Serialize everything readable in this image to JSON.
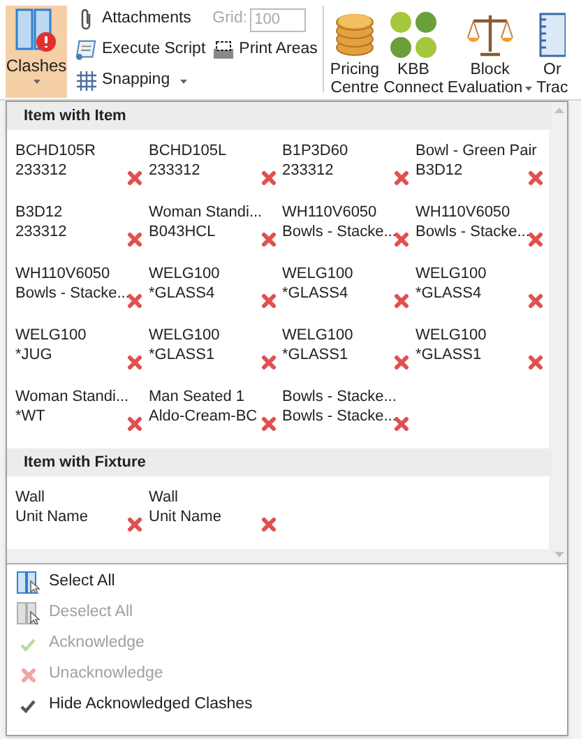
{
  "ribbon": {
    "clashes": {
      "label": "Clashes",
      "selected": true
    },
    "small_buttons": [
      {
        "kind": "attach",
        "label": "Attachments"
      },
      {
        "kind": "script",
        "label": "Execute Script"
      },
      {
        "kind": "snap",
        "label": "Snapping"
      }
    ],
    "grid": {
      "label": "Grid:",
      "value": "100",
      "disabled": true
    },
    "print_areas": {
      "label": "Print Areas"
    },
    "large_buttons": [
      {
        "kind": "coins",
        "lines": [
          "Pricing",
          "Centre"
        ],
        "dropdown": false
      },
      {
        "kind": "dots",
        "lines": [
          "KBB",
          "Connect"
        ],
        "dropdown": false
      },
      {
        "kind": "scales",
        "lines": [
          "Block",
          "Evaluation"
        ],
        "dropdown": true
      },
      {
        "kind": "book",
        "lines": [
          "Or",
          "Trac"
        ],
        "dropdown": false
      }
    ]
  },
  "sections": [
    {
      "title": "Item with Item",
      "items": [
        {
          "line1": "BCHD105R",
          "line2": "233312",
          "acknowledged": false
        },
        {
          "line1": "BCHD105L",
          "line2": "233312",
          "acknowledged": false
        },
        {
          "line1": "B1P3D60",
          "line2": "233312",
          "acknowledged": false
        },
        {
          "line1": "Bowl - Green Pair",
          "line2": "B3D12",
          "acknowledged": false
        },
        {
          "line1": "B3D12",
          "line2": "233312",
          "acknowledged": false
        },
        {
          "line1": "Woman Standi...",
          "line2": "B043HCL",
          "acknowledged": false
        },
        {
          "line1": "WH110V6050",
          "line2": "Bowls - Stacke...",
          "acknowledged": false
        },
        {
          "line1": "WH110V6050",
          "line2": "Bowls - Stacke...",
          "acknowledged": false
        },
        {
          "line1": "WH110V6050",
          "line2": "Bowls - Stacke...",
          "acknowledged": false
        },
        {
          "line1": "WELG100",
          "line2": "*GLASS4",
          "acknowledged": false
        },
        {
          "line1": "WELG100",
          "line2": "*GLASS4",
          "acknowledged": false
        },
        {
          "line1": "WELG100",
          "line2": "*GLASS4",
          "acknowledged": false
        },
        {
          "line1": "WELG100",
          "line2": "*JUG",
          "acknowledged": false
        },
        {
          "line1": "WELG100",
          "line2": "*GLASS1",
          "acknowledged": false
        },
        {
          "line1": "WELG100",
          "line2": "*GLASS1",
          "acknowledged": false
        },
        {
          "line1": "WELG100",
          "line2": "*GLASS1",
          "acknowledged": false
        },
        {
          "line1": "Woman Standi...",
          "line2": "*WT",
          "acknowledged": false
        },
        {
          "line1": "Man Seated 1",
          "line2": "Aldo-Cream-BC",
          "acknowledged": false
        },
        {
          "line1": "Bowls - Stacke...",
          "line2": "Bowls - Stacke...",
          "acknowledged": false
        }
      ]
    },
    {
      "title": "Item with Fixture",
      "items": [
        {
          "line1": "Wall",
          "line2": "Unit Name",
          "acknowledged": false
        },
        {
          "line1": "Wall",
          "line2": "Unit Name",
          "acknowledged": false
        }
      ]
    }
  ],
  "menu": [
    {
      "kind": "select",
      "label": "Select All",
      "disabled": false
    },
    {
      "kind": "deselect",
      "label": "Deselect All",
      "disabled": true
    },
    {
      "kind": "acknowledge",
      "label": "Acknowledge",
      "disabled": true
    },
    {
      "kind": "unacknowledge",
      "label": "Unacknowledge",
      "disabled": true
    },
    {
      "kind": "toggle",
      "label": "Hide Acknowledged Clashes",
      "disabled": false,
      "checked": true
    }
  ]
}
